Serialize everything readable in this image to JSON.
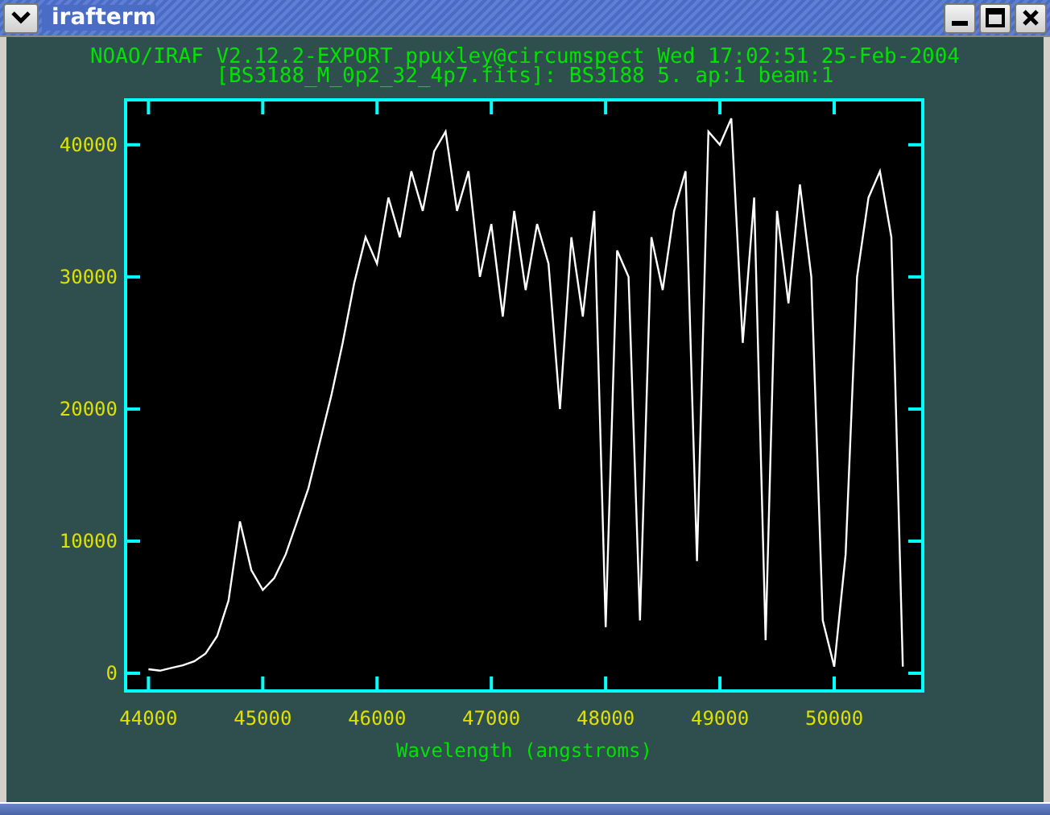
{
  "window": {
    "title": "irafterm"
  },
  "plot": {
    "header": [
      "NOAO/IRAF V2.12.2-EXPORT ppuxley@circumspect Wed 17:02:51 25-Feb-2004",
      "[BS3188_M_0p2_32_4p7.fits]: BS3188 5. ap:1 beam:1"
    ],
    "chart_data": {
      "type": "line",
      "xlabel": "Wavelength (angstroms)",
      "xlim": [
        43800,
        50775
      ],
      "ylim": [
        -1340,
        43400
      ],
      "xticks": [
        44000,
        45000,
        46000,
        47000,
        48000,
        49000,
        50000
      ],
      "yticks": [
        0,
        10000,
        20000,
        30000,
        40000
      ],
      "x": [
        44000,
        44100,
        44200,
        44300,
        44400,
        44500,
        44600,
        44700,
        44800,
        44900,
        45000,
        45100,
        45200,
        45300,
        45400,
        45500,
        45600,
        45700,
        45800,
        45900,
        46000,
        46100,
        46200,
        46300,
        46400,
        46500,
        46600,
        46700,
        46800,
        46900,
        47000,
        47100,
        47200,
        47300,
        47400,
        47500,
        47600,
        47700,
        47800,
        47900,
        48000,
        48100,
        48200,
        48300,
        48400,
        48500,
        48600,
        48700,
        48800,
        48900,
        49000,
        49100,
        49200,
        49300,
        49400,
        49500,
        49600,
        49700,
        49800,
        49900,
        50000,
        50100,
        50200,
        50300,
        50400,
        50500,
        50600
      ],
      "series": [
        {
          "color": "#ffffff",
          "values": [
            300,
            200,
            400,
            600,
            900,
            1500,
            2800,
            5500,
            11500,
            7800,
            6300,
            7200,
            9000,
            11500,
            14000,
            17500,
            21000,
            25000,
            29500,
            33000,
            31000,
            36000,
            33000,
            38000,
            35000,
            39500,
            41000,
            35000,
            38000,
            30000,
            34000,
            27000,
            35000,
            29000,
            34000,
            31000,
            20000,
            33000,
            27000,
            35000,
            3500,
            32000,
            30000,
            4000,
            33000,
            29000,
            35000,
            38000,
            8500,
            41000,
            40000,
            42000,
            25000,
            36000,
            2500,
            35000,
            28000,
            37000,
            30000,
            4000,
            500,
            9000,
            30000,
            36000,
            38000,
            33000,
            500
          ]
        }
      ]
    }
  }
}
